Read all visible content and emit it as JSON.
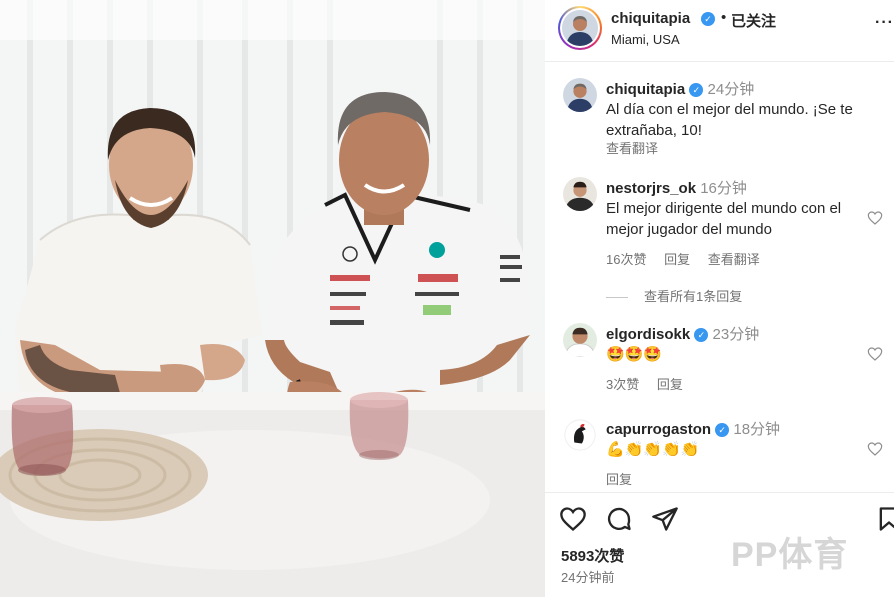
{
  "post": {
    "username": "chiquitapia",
    "verified": true,
    "separator": "•",
    "follow_status": "已关注",
    "location": "Miami, USA",
    "more_icon": "ellipsis-icon"
  },
  "caption": {
    "username": "chiquitapia",
    "time": "24分钟",
    "text": "Al día con el mejor del mundo. ¡Se te extrañaba, 10!",
    "translate": "查看翻译"
  },
  "comments": [
    {
      "username": "nestorjrs_ok",
      "verified": false,
      "time": "16分钟",
      "text": "El mejor dirigente del mundo con el mejor jugador del mundo",
      "likes": "16次赞",
      "reply": "回复",
      "translate": "查看翻译",
      "view_replies": "查看所有1条回复"
    },
    {
      "username": "elgordisokk",
      "verified": true,
      "time": "23分钟",
      "text": "🤩🤩🤩",
      "likes": "3次赞",
      "reply": "回复"
    },
    {
      "username": "capurrogaston",
      "verified": true,
      "time": "18分钟",
      "text": "💪👏👏👏👏",
      "reply": "回复"
    }
  ],
  "actions": {
    "like_icon": "heart-icon",
    "comment_icon": "comment-icon",
    "share_icon": "share-icon",
    "save_icon": "bookmark-icon",
    "likes": "5893次赞",
    "time_ago": "24分钟前"
  },
  "watermark": "PP体育",
  "colors": {
    "verified": "#3897f0",
    "text": "#262626",
    "secondary": "#737373"
  }
}
